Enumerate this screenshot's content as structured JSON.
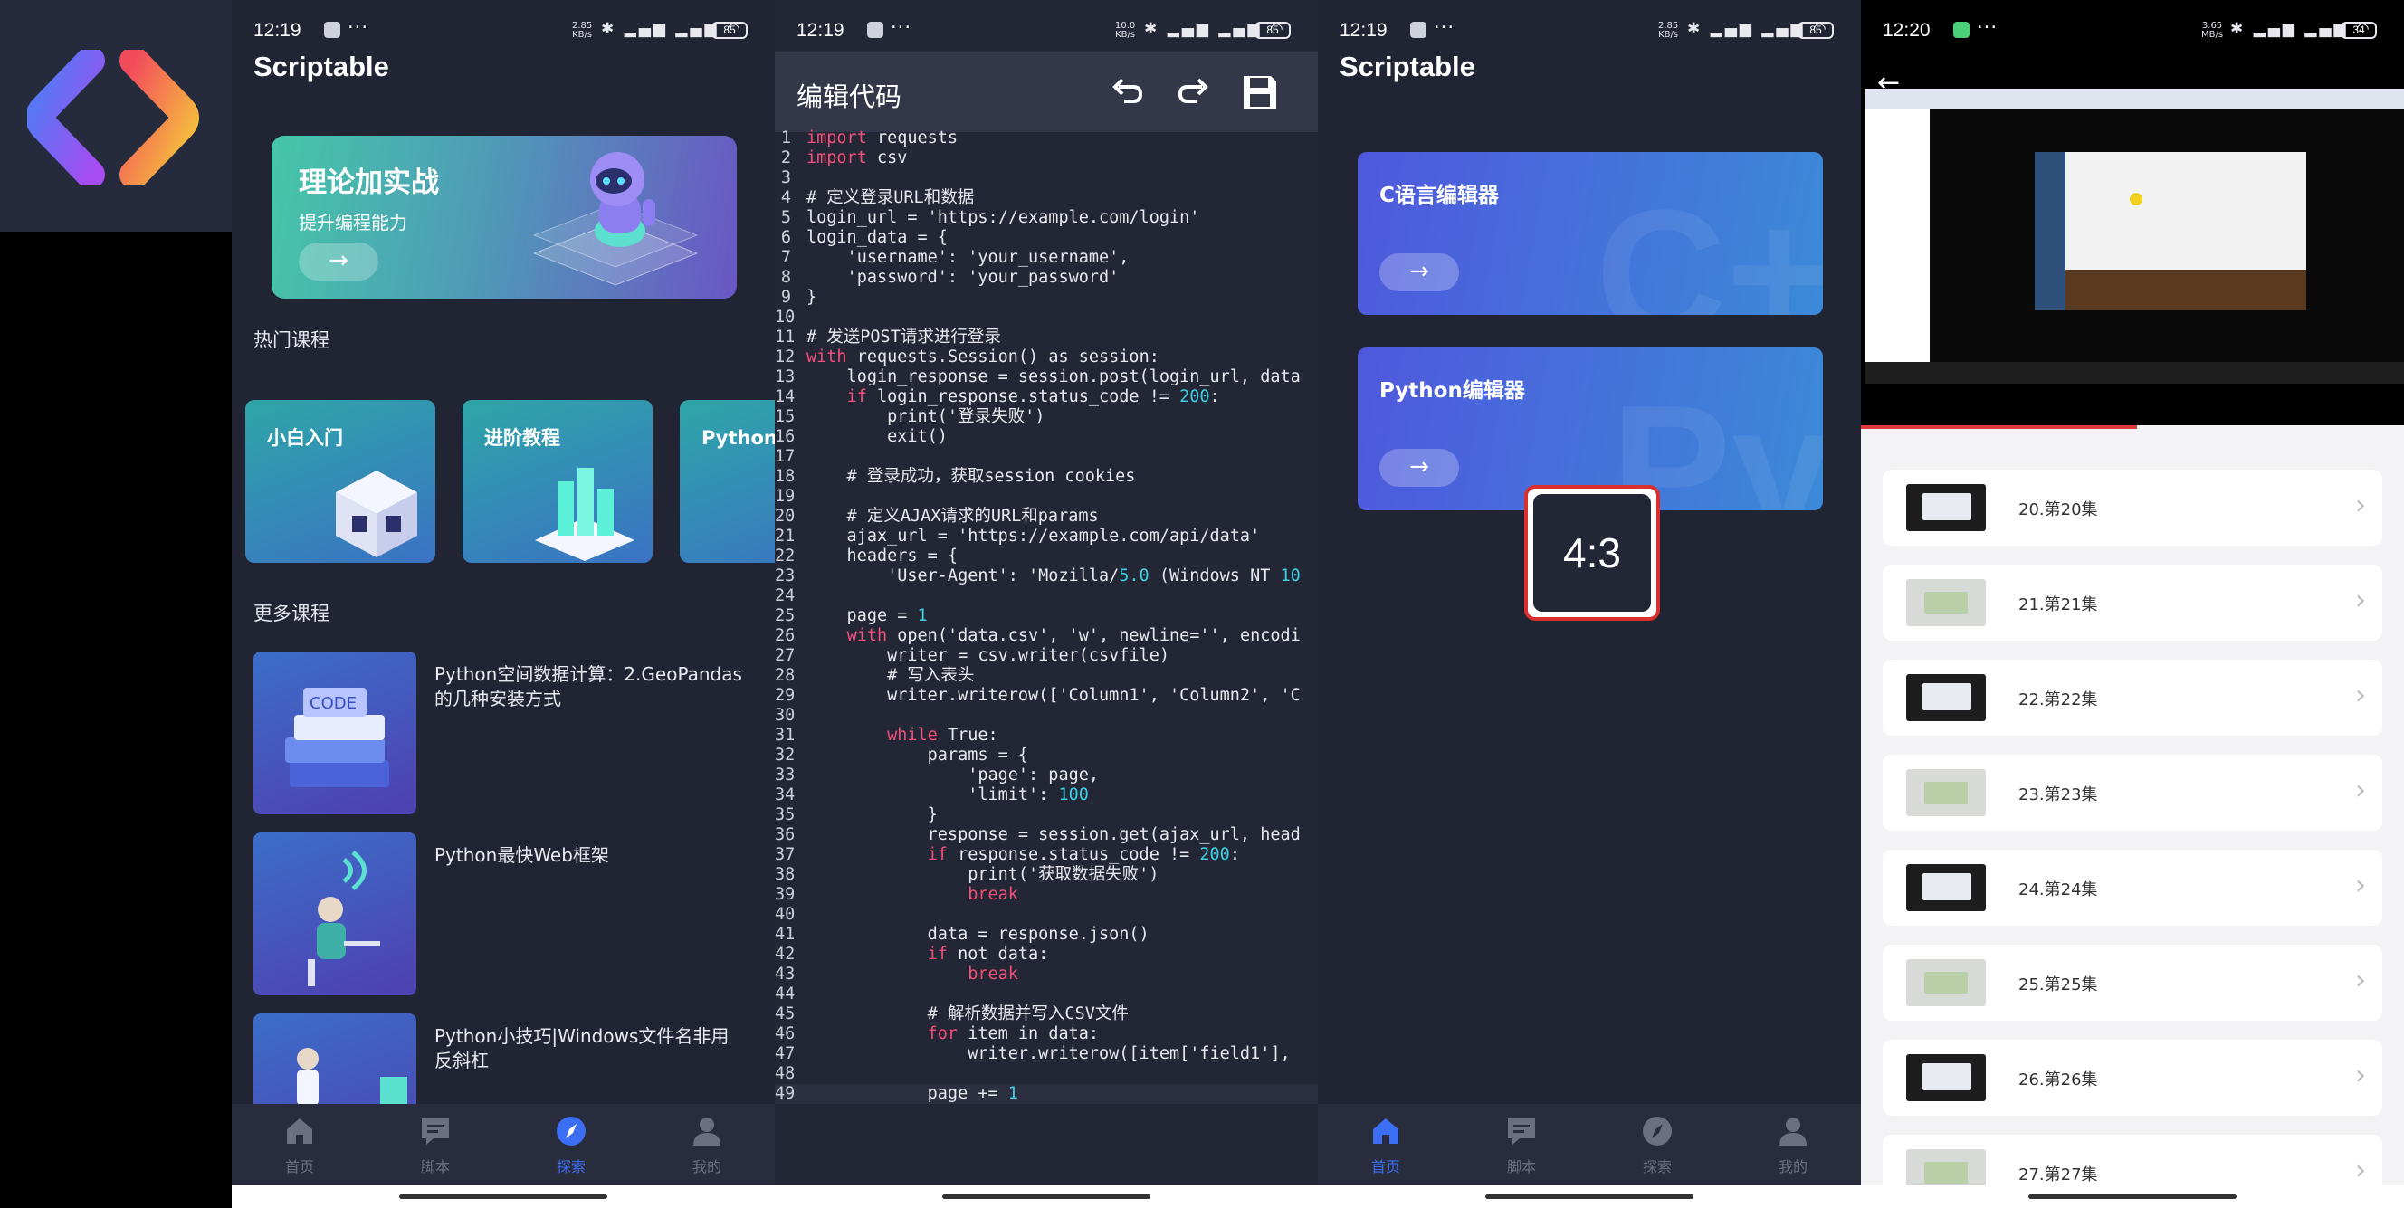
{
  "status": [
    {
      "time": "12:19",
      "net": "2.85\nKB/s",
      "battery": "85"
    },
    {
      "time": "12:19",
      "net": "10.0\nKB/s",
      "battery": "85"
    },
    {
      "time": "12:19",
      "net": "2.85\nKB/s",
      "battery": "85"
    },
    {
      "time": "12:20",
      "net": "3.65\nMB/s",
      "battery": "34"
    }
  ],
  "explore": {
    "app_title": "Scriptable",
    "banner": {
      "title": "理论加实战",
      "subtitle": "提升编程能力",
      "arrow": "→"
    },
    "hot_section": "热门课程",
    "hot_courses": [
      "小白入门",
      "进阶教程",
      "Python 提"
    ],
    "more_section": "更多课程",
    "more_courses": [
      "Python空间数据计算：2.GeoPandas的几种安装方式",
      "Python最快Web框架",
      "Python小技巧|Windows文件名非用反斜杠"
    ],
    "tabs": [
      "首页",
      "脚本",
      "探索",
      "我的"
    ]
  },
  "editor": {
    "title": "编辑代码",
    "lines": [
      "import requests",
      "import csv",
      "",
      "# 定义登录URL和数据",
      "login_url = 'https://example.com/login'",
      "login_data = {",
      "    'username': 'your_username',",
      "    'password': 'your_password'",
      "}",
      "",
      "# 发送POST请求进行登录",
      "with requests.Session() as session:",
      "    login_response = session.post(login_url, data",
      "    if login_response.status_code != 200:",
      "        print('登录失败')",
      "        exit()",
      "",
      "    # 登录成功，获取session cookies",
      "",
      "    # 定义AJAX请求的URL和params",
      "    ajax_url = 'https://example.com/api/data'",
      "    headers = {",
      "        'User-Agent': 'Mozilla/5.0 (Windows NT 10",
      "",
      "    page = 1",
      "    with open('data.csv', 'w', newline='', encodi",
      "        writer = csv.writer(csvfile)",
      "        # 写入表头",
      "        writer.writerow(['Column1', 'Column2', 'C",
      "",
      "        while True:",
      "            params = {",
      "                'page': page,",
      "                'limit': 100",
      "            }",
      "            response = session.get(ajax_url, head",
      "            if response.status_code != 200:",
      "                print('获取数据失败')",
      "                break",
      "",
      "            data = response.json()",
      "            if not data:",
      "                break",
      "",
      "            # 解析数据并写入CSV文件",
      "            for item in data:",
      "                writer.writerow([item['field1'],",
      "",
      "            page += 1"
    ]
  },
  "editors_screen": {
    "app_title": "Scriptable",
    "cards": [
      {
        "label": "C语言编辑器",
        "arrow": "→"
      },
      {
        "label": "Python编辑器",
        "arrow": "→"
      }
    ],
    "ratio_label": "4:3",
    "tabs": [
      "首页",
      "脚本",
      "探索",
      "我的"
    ]
  },
  "video": {
    "back": "←",
    "episodes": [
      "20.第20集",
      "21.第21集",
      "22.第22集",
      "23.第23集",
      "24.第24集",
      "25.第25集",
      "26.第26集",
      "27.第27集"
    ]
  },
  "colors": {
    "accent": "#3c6ef3",
    "keyword": "#f2507a",
    "number": "#3fd0e6",
    "panel_bg": "#212433"
  }
}
